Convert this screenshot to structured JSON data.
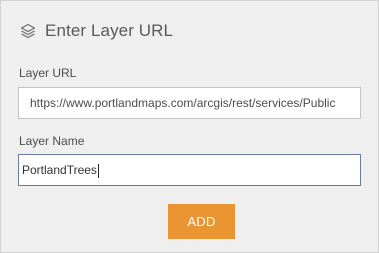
{
  "header": {
    "title": "Enter Layer URL",
    "icon": "layers-icon"
  },
  "layer_url": {
    "label": "Layer URL",
    "value": "https://www.portlandmaps.com/arcgis/rest/services/Public"
  },
  "layer_name": {
    "label": "Layer Name",
    "value": "PortlandTrees"
  },
  "actions": {
    "add_label": "ADD"
  },
  "colors": {
    "panel_background": "#efefef",
    "accent_button": "#ea9532",
    "focused_border": "#6b7aa0"
  }
}
